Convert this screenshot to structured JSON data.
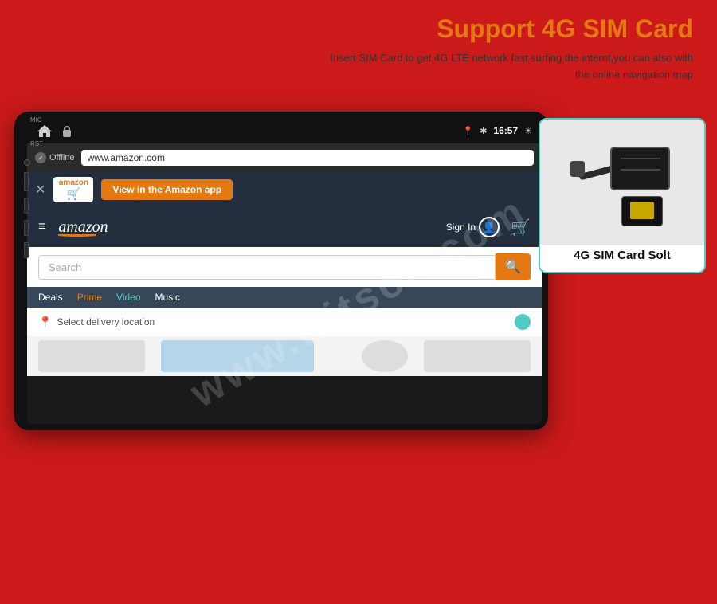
{
  "page": {
    "background_color": "#cc1a1a"
  },
  "header": {
    "title_prefix": "Support ",
    "title_highlight": "4G SIM Card",
    "subtitle_line1": "Insert SIM Card to get 4G LTE network fast surfing the internt,you can also with",
    "subtitle_line2": "the online navigation map"
  },
  "status_bar": {
    "mic_label": "MIC",
    "rst_label": "RST",
    "time": "16:57",
    "location_icon": "📍",
    "bluetooth_icon": "⚡"
  },
  "browser": {
    "offline_text": "Offline",
    "url": "www.amazon.com"
  },
  "amazon_banner": {
    "close_icon": "✕",
    "amazon_text": "amazon",
    "view_app_text": "View in the Amazon app"
  },
  "amazon_site": {
    "hamburger": "≡",
    "logo_text": "amazon",
    "sign_in_text": "Sign In",
    "search_placeholder": "Search",
    "nav_links": [
      {
        "text": "Deals",
        "style": "white"
      },
      {
        "text": "Prime",
        "style": "orange"
      },
      {
        "text": "Video",
        "style": "teal"
      },
      {
        "text": "Music",
        "style": "white"
      }
    ],
    "delivery_text": "Select delivery location"
  },
  "sim_card_box": {
    "label": "4G SIM Card Solt"
  },
  "watermark": {
    "text": "www.witson.com"
  }
}
